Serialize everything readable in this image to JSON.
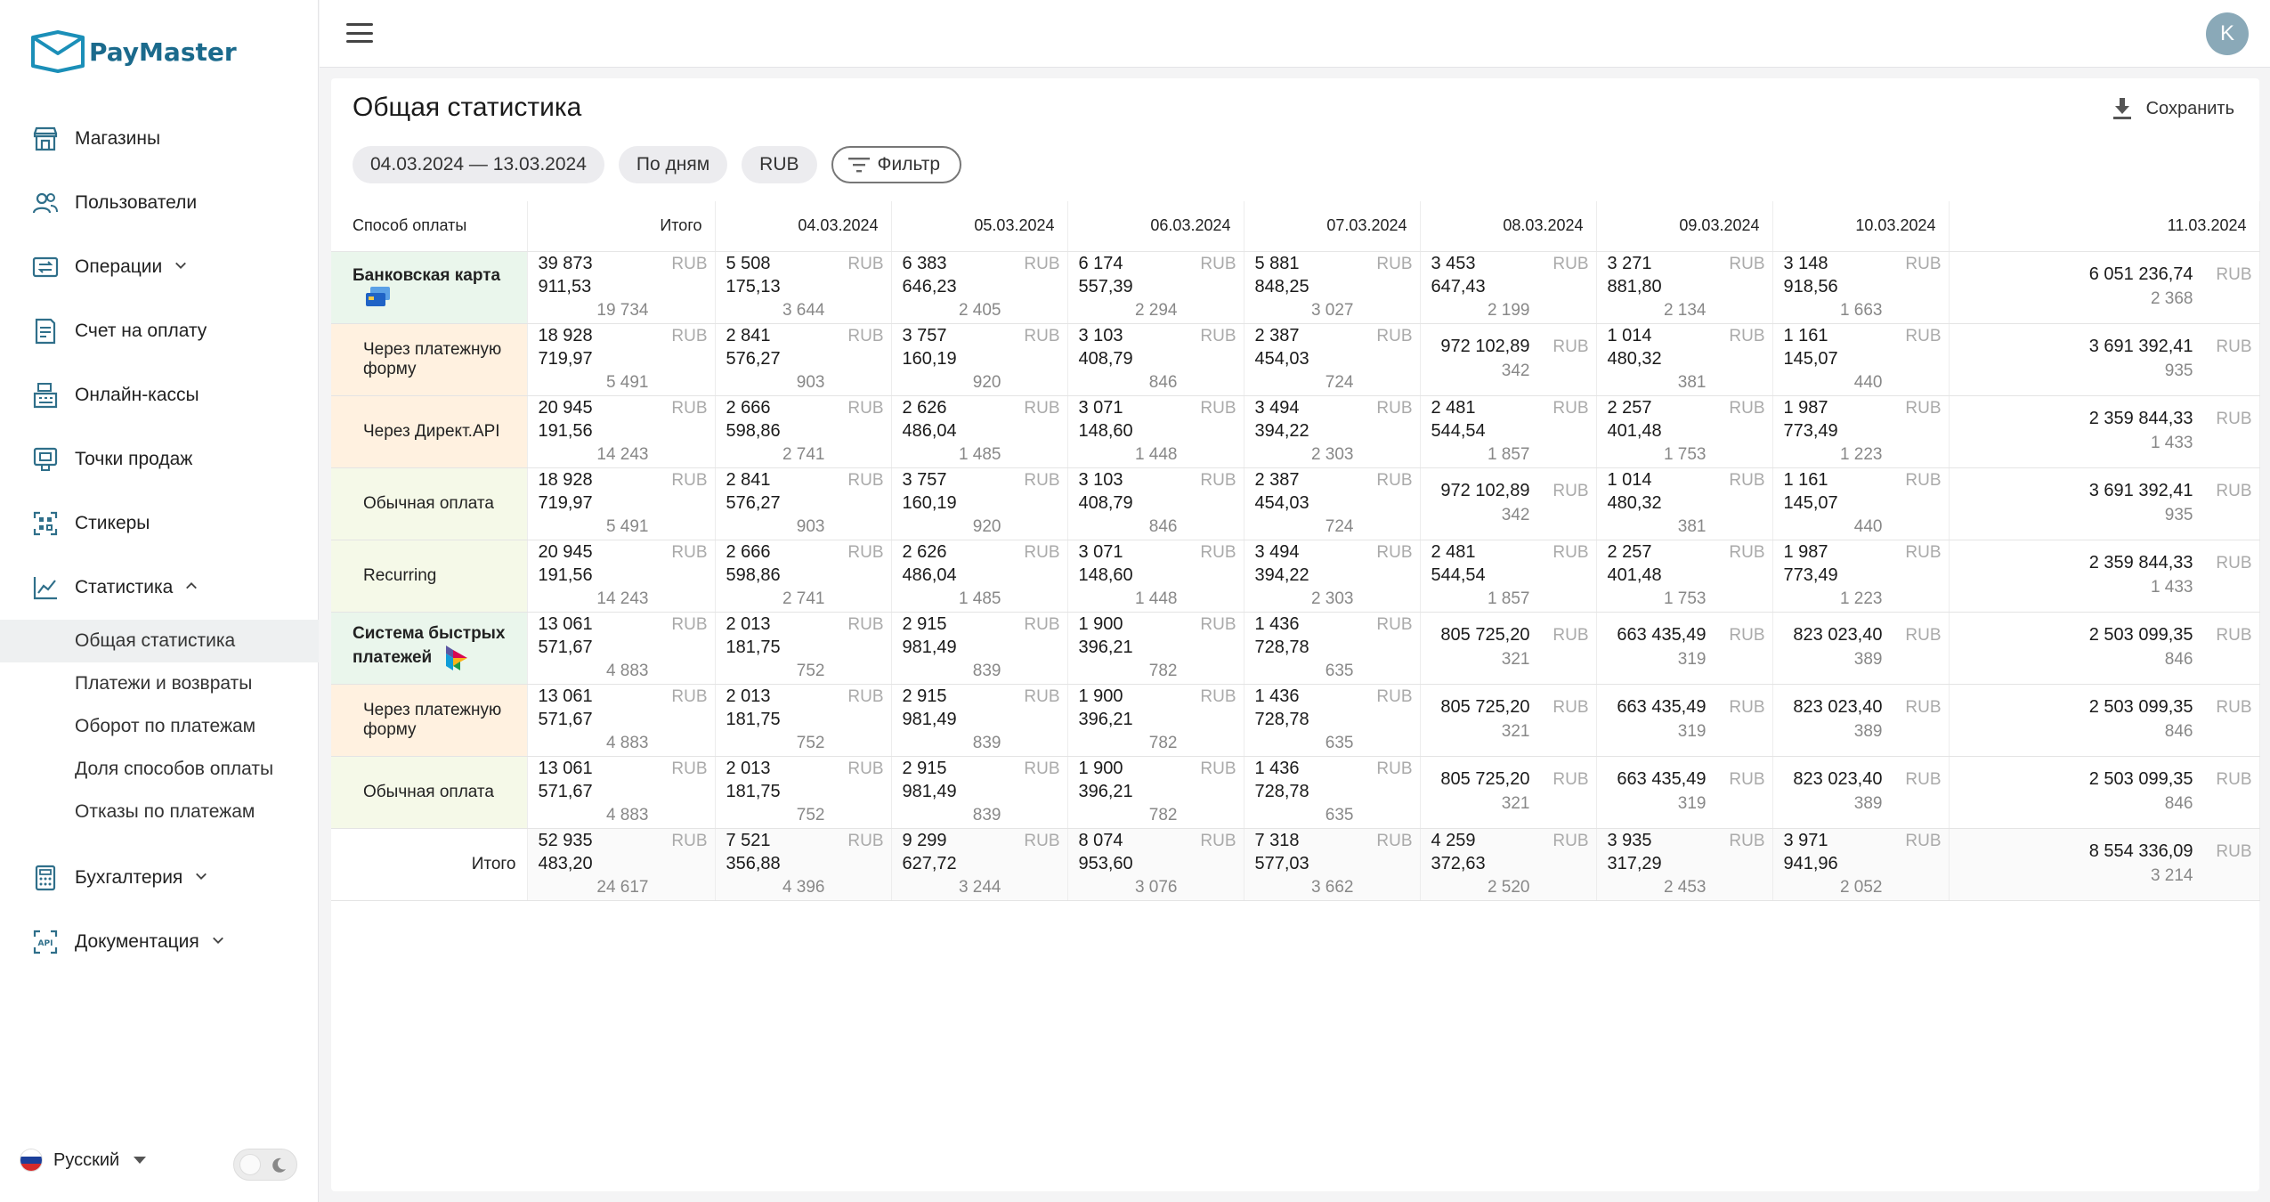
{
  "brand": {
    "name": "PayMaster"
  },
  "topbar": {
    "avatar_letter": "K"
  },
  "sidebar": {
    "items": [
      {
        "label": "Магазины",
        "icon": "store-icon"
      },
      {
        "label": "Пользователи",
        "icon": "users-icon"
      },
      {
        "label": "Операции",
        "icon": "operations-icon",
        "chevron": "down"
      },
      {
        "label": "Счет на оплату",
        "icon": "invoice-icon"
      },
      {
        "label": "Онлайн-кассы",
        "icon": "cash-register-icon"
      },
      {
        "label": "Точки продаж",
        "icon": "pos-icon"
      },
      {
        "label": "Стикеры",
        "icon": "qr-icon"
      },
      {
        "label": "Статистика",
        "icon": "chart-icon",
        "chevron": "up"
      }
    ],
    "stats_sub": [
      {
        "label": "Общая статистика",
        "active": true
      },
      {
        "label": "Платежи и возвраты"
      },
      {
        "label": "Оборот по платежам"
      },
      {
        "label": "Доля способов оплаты"
      },
      {
        "label": "Отказы по платежам"
      }
    ],
    "bottom_items": [
      {
        "label": "Бухгалтерия",
        "icon": "calculator-icon",
        "chevron": "down"
      },
      {
        "label": "Документация",
        "icon": "api-icon",
        "chevron": "down"
      }
    ],
    "language": "Русский"
  },
  "page": {
    "title": "Общая статистика",
    "save_label": "Сохранить",
    "filters": {
      "date_range": "04.03.2024 — 13.03.2024",
      "grouping": "По дням",
      "currency": "RUB",
      "filter_label": "Фильтр"
    }
  },
  "table": {
    "method_header": "Способ оплаты",
    "columns": [
      "Итого",
      "04.03.2024",
      "05.03.2024",
      "06.03.2024",
      "07.03.2024",
      "08.03.2024",
      "09.03.2024",
      "10.03.2024",
      "11.03.2024"
    ],
    "currency": "RUB",
    "rows": [
      {
        "label": "Банковская карта",
        "style": "green",
        "bold": true,
        "icon": "bank-card-icon",
        "cells": [
          [
            "39 873 911,53",
            "19 734"
          ],
          [
            "5 508 175,13",
            "3 644"
          ],
          [
            "6 383 646,23",
            "2 405"
          ],
          [
            "6 174 557,39",
            "2 294"
          ],
          [
            "5 881 848,25",
            "3 027"
          ],
          [
            "3 453 647,43",
            "2 199"
          ],
          [
            "3 271 881,80",
            "2 134"
          ],
          [
            "3 148 918,56",
            "1 663"
          ],
          [
            "6 051 236,74",
            "2 368"
          ]
        ]
      },
      {
        "label": "Через платежную форму",
        "style": "orange",
        "cells": [
          [
            "18 928 719,97",
            "5 491"
          ],
          [
            "2 841 576,27",
            "903"
          ],
          [
            "3 757 160,19",
            "920"
          ],
          [
            "3 103 408,79",
            "846"
          ],
          [
            "2 387 454,03",
            "724"
          ],
          [
            "972 102,89",
            "342"
          ],
          [
            "1 014 480,32",
            "381"
          ],
          [
            "1 161 145,07",
            "440"
          ],
          [
            "3 691 392,41",
            "935"
          ]
        ]
      },
      {
        "label": "Через Директ.API",
        "style": "orange",
        "cells": [
          [
            "20 945 191,56",
            "14 243"
          ],
          [
            "2 666 598,86",
            "2 741"
          ],
          [
            "2 626 486,04",
            "1 485"
          ],
          [
            "3 071 148,60",
            "1 448"
          ],
          [
            "3 494 394,22",
            "2 303"
          ],
          [
            "2 481 544,54",
            "1 857"
          ],
          [
            "2 257 401,48",
            "1 753"
          ],
          [
            "1 987 773,49",
            "1 223"
          ],
          [
            "2 359 844,33",
            "1 433"
          ]
        ]
      },
      {
        "label": "Обычная оплата",
        "style": "lime",
        "cells": [
          [
            "18 928 719,97",
            "5 491"
          ],
          [
            "2 841 576,27",
            "903"
          ],
          [
            "3 757 160,19",
            "920"
          ],
          [
            "3 103 408,79",
            "846"
          ],
          [
            "2 387 454,03",
            "724"
          ],
          [
            "972 102,89",
            "342"
          ],
          [
            "1 014 480,32",
            "381"
          ],
          [
            "1 161 145,07",
            "440"
          ],
          [
            "3 691 392,41",
            "935"
          ]
        ]
      },
      {
        "label": "Recurring",
        "style": "lime",
        "cells": [
          [
            "20 945 191,56",
            "14 243"
          ],
          [
            "2 666 598,86",
            "2 741"
          ],
          [
            "2 626 486,04",
            "1 485"
          ],
          [
            "3 071 148,60",
            "1 448"
          ],
          [
            "3 494 394,22",
            "2 303"
          ],
          [
            "2 481 544,54",
            "1 857"
          ],
          [
            "2 257 401,48",
            "1 753"
          ],
          [
            "1 987 773,49",
            "1 223"
          ],
          [
            "2 359 844,33",
            "1 433"
          ]
        ]
      },
      {
        "label": "Система быстрых платежей",
        "style": "green",
        "bold": true,
        "icon": "sbp-icon",
        "cells": [
          [
            "13 061 571,67",
            "4 883"
          ],
          [
            "2 013 181,75",
            "752"
          ],
          [
            "2 915 981,49",
            "839"
          ],
          [
            "1 900 396,21",
            "782"
          ],
          [
            "1 436 728,78",
            "635"
          ],
          [
            "805 725,20",
            "321"
          ],
          [
            "663 435,49",
            "319"
          ],
          [
            "823 023,40",
            "389"
          ],
          [
            "2 503 099,35",
            "846"
          ]
        ]
      },
      {
        "label": "Через платежную форму",
        "style": "orange",
        "cells": [
          [
            "13 061 571,67",
            "4 883"
          ],
          [
            "2 013 181,75",
            "752"
          ],
          [
            "2 915 981,49",
            "839"
          ],
          [
            "1 900 396,21",
            "782"
          ],
          [
            "1 436 728,78",
            "635"
          ],
          [
            "805 725,20",
            "321"
          ],
          [
            "663 435,49",
            "319"
          ],
          [
            "823 023,40",
            "389"
          ],
          [
            "2 503 099,35",
            "846"
          ]
        ]
      },
      {
        "label": "Обычная оплата",
        "style": "lime",
        "cells": [
          [
            "13 061 571,67",
            "4 883"
          ],
          [
            "2 013 181,75",
            "752"
          ],
          [
            "2 915 981,49",
            "839"
          ],
          [
            "1 900 396,21",
            "782"
          ],
          [
            "1 436 728,78",
            "635"
          ],
          [
            "805 725,20",
            "321"
          ],
          [
            "663 435,49",
            "319"
          ],
          [
            "823 023,40",
            "389"
          ],
          [
            "2 503 099,35",
            "846"
          ]
        ]
      },
      {
        "label": "Итого",
        "style": "total",
        "cells": [
          [
            "52 935 483,20",
            "24 617"
          ],
          [
            "7 521 356,88",
            "4 396"
          ],
          [
            "9 299 627,72",
            "3 244"
          ],
          [
            "8 074 953,60",
            "3 076"
          ],
          [
            "7 318 577,03",
            "3 662"
          ],
          [
            "4 259 372,63",
            "2 520"
          ],
          [
            "3 935 317,29",
            "2 453"
          ],
          [
            "3 971 941,96",
            "2 052"
          ],
          [
            "8 554 336,09",
            "3 214"
          ]
        ]
      }
    ]
  }
}
